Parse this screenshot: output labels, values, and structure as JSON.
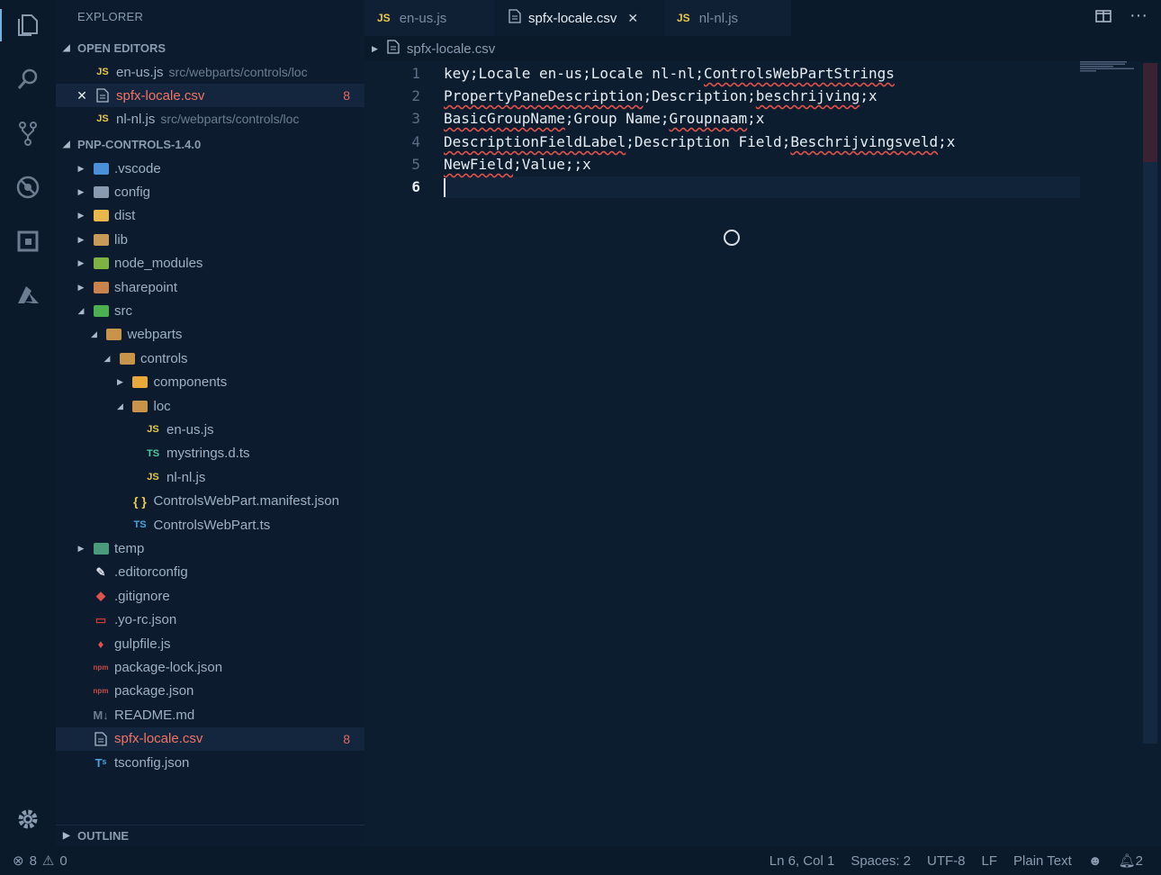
{
  "activity": [
    "files-icon",
    "search-icon",
    "source-control-icon",
    "debug-icon",
    "extensions-icon",
    "azure-icon",
    "settings-gear-icon"
  ],
  "explorer": {
    "title": "EXPLORER",
    "open_editors_header": "OPEN EDITORS",
    "open_editors": [
      {
        "icon": "JS",
        "name": "en-us.js",
        "desc": "src/webparts/controls/loc"
      },
      {
        "icon": "csv",
        "name": "spfx-locale.csv",
        "desc": "",
        "badge": "8"
      },
      {
        "icon": "JS",
        "name": "nl-nl.js",
        "desc": "src/webparts/controls/loc"
      }
    ],
    "project_header": "PNP-CONTROLS-1.4.0",
    "tree": [
      {
        "name": ".vscode",
        "type": "folder",
        "depth": 0,
        "open": false
      },
      {
        "name": "config",
        "type": "folder",
        "depth": 0,
        "open": false
      },
      {
        "name": "dist",
        "type": "folder",
        "depth": 0,
        "open": false
      },
      {
        "name": "lib",
        "type": "folder",
        "depth": 0,
        "open": false
      },
      {
        "name": "node_modules",
        "type": "folder",
        "depth": 0,
        "open": false
      },
      {
        "name": "sharepoint",
        "type": "folder",
        "depth": 0,
        "open": false
      },
      {
        "name": "src",
        "type": "folder",
        "depth": 0,
        "open": true
      },
      {
        "name": "webparts",
        "type": "folder",
        "depth": 1,
        "open": true
      },
      {
        "name": "controls",
        "type": "folder",
        "depth": 2,
        "open": true
      },
      {
        "name": "components",
        "type": "folder",
        "depth": 3,
        "open": false
      },
      {
        "name": "loc",
        "type": "folder",
        "depth": 3,
        "open": true
      },
      {
        "name": "en-us.js",
        "type": "JS",
        "depth": 4
      },
      {
        "name": "mystrings.d.ts",
        "type": "TS",
        "depth": 4
      },
      {
        "name": "nl-nl.js",
        "type": "JS",
        "depth": 4
      },
      {
        "name": "ControlsWebPart.manifest.json",
        "type": "json",
        "depth": 3
      },
      {
        "name": "ControlsWebPart.ts",
        "type": "TS",
        "depth": 3
      },
      {
        "name": "temp",
        "type": "folder",
        "depth": 0,
        "open": false
      },
      {
        "name": ".editorconfig",
        "type": "file",
        "depth": 0
      },
      {
        "name": ".gitignore",
        "type": "file",
        "depth": 0
      },
      {
        "name": ".yo-rc.json",
        "type": "file",
        "depth": 0
      },
      {
        "name": "gulpfile.js",
        "type": "file",
        "depth": 0
      },
      {
        "name": "package-lock.json",
        "type": "file",
        "depth": 0
      },
      {
        "name": "package.json",
        "type": "file",
        "depth": 0
      },
      {
        "name": "README.md",
        "type": "file",
        "depth": 0
      },
      {
        "name": "spfx-locale.csv",
        "type": "csv",
        "depth": 0,
        "badge": "8"
      },
      {
        "name": "tsconfig.json",
        "type": "file",
        "depth": 0
      }
    ],
    "outline_header": "OUTLINE"
  },
  "tabs": [
    {
      "icon": "JS",
      "label": "en-us.js"
    },
    {
      "icon": "csv",
      "label": "spfx-locale.csv",
      "active": true
    },
    {
      "icon": "JS",
      "label": "nl-nl.js"
    }
  ],
  "breadcrumb": "spfx-locale.csv",
  "editor": {
    "line_numbers": [
      "1",
      "2",
      "3",
      "4",
      "5",
      "6"
    ],
    "lines": [
      "key;Locale en-us;Locale nl-nl;ControlsWebPartStrings",
      "PropertyPaneDescription;Description;beschrijving;x",
      "BasicGroupName;Group Name;Groupnaam;x",
      "DescriptionFieldLabel;Description Field;Beschrijvingsveld;x",
      "NewField;Value;;x",
      ""
    ]
  },
  "status": {
    "errors": "8",
    "warnings": "0",
    "position": "Ln 6, Col 1",
    "spaces": "Spaces: 2",
    "encoding": "UTF-8",
    "eol": "LF",
    "language": "Plain Text",
    "notifications": "2"
  }
}
